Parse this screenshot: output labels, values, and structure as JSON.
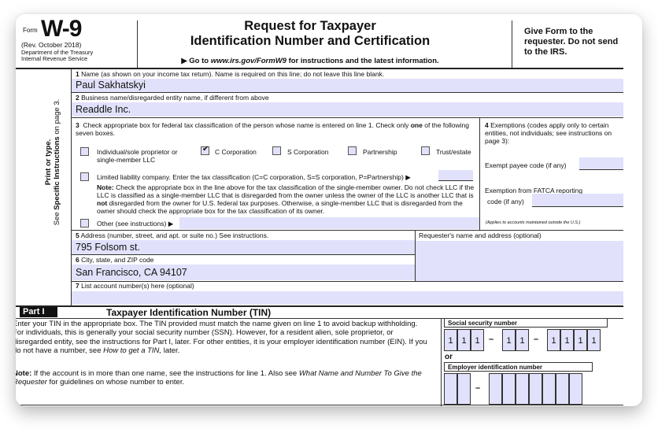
{
  "header": {
    "form_word": "Form",
    "form_number": "W-9",
    "revision": "(Rev. October 2018)",
    "department": "Department of the Treasury",
    "service": "Internal Revenue Service",
    "title_line1": "Request for Taxpayer",
    "title_line2": "Identification Number and Certification",
    "goto_prefix": "▶ Go to ",
    "goto_url": "www.irs.gov/FormW9",
    "goto_suffix": " for instructions and the latest information.",
    "give_form": "Give Form to the requester. Do not send to the IRS."
  },
  "side_text": {
    "line1": "Print or type.",
    "line2_prefix": "See ",
    "line2_bold": "Specific Instructions",
    "line2_suffix": " on page 3."
  },
  "line1": {
    "num": "1",
    "label": "Name (as shown on your income tax return). Name is required on this line; do not leave this line blank.",
    "value": "Paul Sakhatskyi"
  },
  "line2": {
    "num": "2",
    "label": "Business name/disregarded entity name, if different from above",
    "value": "Readdle Inc."
  },
  "line3": {
    "num": "3",
    "label_a": "Check appropriate box for federal tax classification of the person whose name is entered on line 1. Check only ",
    "label_bold": "one",
    "label_b": " of the following seven boxes.",
    "options": [
      {
        "label": "Individual/sole proprietor or single-member LLC",
        "checked": false
      },
      {
        "label": "C Corporation",
        "checked": true
      },
      {
        "label": "S Corporation",
        "checked": false
      },
      {
        "label": "Partnership",
        "checked": false
      },
      {
        "label": "Trust/estate",
        "checked": false
      }
    ],
    "llc_label": "Limited liability company. Enter the tax classification (C=C corporation, S=S corporation, P=Partnership) ▶",
    "llc_value": "",
    "note_bold": "Note:",
    "note_a": " Check the appropriate box in the line above for the tax classification of the single-member owner.  Do not check LLC if the LLC is classified as a single-member LLC that is disregarded from the owner unless the owner of the LLC is another LLC that is ",
    "note_not": "not",
    "note_b": " disregarded from the owner for U.S. federal tax purposes. Otherwise, a single-member LLC that is disregarded from the owner should check the appropriate box for the tax classification of its owner.",
    "other_label": "Other (see instructions) ▶",
    "other_value": "",
    "check_mark": "✔"
  },
  "line4": {
    "num": "4",
    "label": "Exemptions (codes apply only to certain entities, not individuals; see instructions on page 3):",
    "exempt_payee_label": "Exempt payee code (if any)",
    "exempt_payee_value": "",
    "fatca_label_1": "Exemption from FATCA reporting",
    "fatca_label_2": "code (if any)",
    "fatca_value": "",
    "applies_note": "(Applies to accounts maintained outside the U.S.)"
  },
  "line5": {
    "num": "5",
    "label": "Address (number, street, and apt. or suite no.) See instructions.",
    "value": "795 Folsom st."
  },
  "requester": {
    "label": "Requester's name and address (optional)",
    "value": ""
  },
  "line6": {
    "num": "6",
    "label": "City, state, and ZIP code",
    "value": "San Francisco, CA 94107"
  },
  "line7": {
    "num": "7",
    "label": "List account number(s) here (optional)",
    "value": ""
  },
  "part1": {
    "badge": "Part I",
    "title": "Taxpayer Identification Number (TIN)",
    "para_a": "Enter your TIN in the appropriate box. The TIN provided must match the name given on line 1 to avoid backup withholding. For individuals, this is generally your social security number (SSN). However, for a resident alien, sole proprietor, or disregarded entity, see the instructions for Part I, later. For other entities, it is your employer identification number (EIN). If you do not have a number, see ",
    "para_italic": "How to get a TIN,",
    "para_b": " later.",
    "note_bold": "Note:",
    "note_a": " If the account is in more than one name, see the instructions for line 1. Also see ",
    "note_italic": "What Name and Number To Give the Requester",
    "note_b": " for guidelines on whose number to enter.",
    "ssn_label": "Social security number",
    "ssn_digits": [
      "1",
      "1",
      "1",
      "1",
      "1",
      "1",
      "1",
      "1",
      "1"
    ],
    "or_label": "or",
    "ein_label": "Employer identification number",
    "ein_digits": [
      "",
      "",
      "",
      "",
      "",
      "",
      "",
      "",
      ""
    ],
    "dash": "–"
  }
}
